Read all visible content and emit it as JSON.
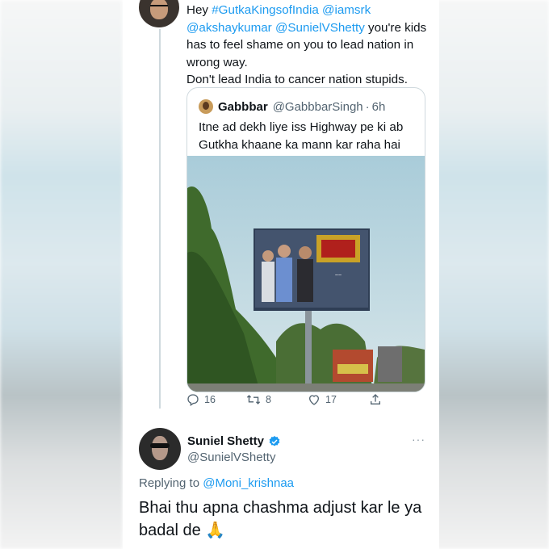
{
  "tweet1": {
    "text_prefix": "Hey ",
    "hashtag": "#GutkaKingsofIndia",
    "mention1": "@iamsrk",
    "mention2": "@akshaykumar",
    "mention3": "@SunielVShetty",
    "text_body": " you're kids has to feel shame on you to lead nation in wrong way.",
    "text_line2": "Don't lead India to cancer nation stupids."
  },
  "quote": {
    "name": "Gabbbar",
    "handle": "@GabbbarSingh",
    "dot": "·",
    "time": "6h",
    "text": "Itne ad dekh liye iss Highway pe ki ab Gutkha khaane ka mann kar raha hai"
  },
  "actions": {
    "replies": "16",
    "retweets": "8",
    "likes": "17"
  },
  "tweet2": {
    "name": "Suniel Shetty",
    "handle": "@SunielVShetty",
    "more": "···",
    "replying_label": "Replying to ",
    "replying_to": "@Moni_krishnaa",
    "text": "Bhai thu apna chashma adjust kar le ya badal de 🙏"
  },
  "colors": {
    "link": "#1d9bf0",
    "verified": "#1d9bf0",
    "secondary": "#536471"
  }
}
